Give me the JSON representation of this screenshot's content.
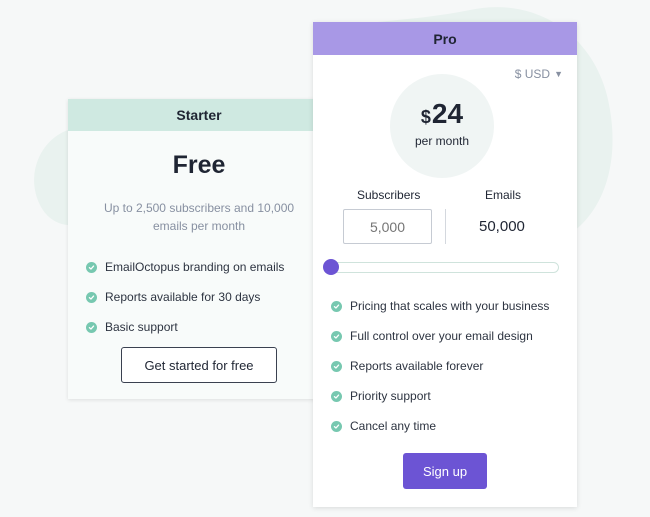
{
  "colors": {
    "starter_header": "#cfe9e1",
    "pro_header": "#a898e6",
    "accent": "#6c54d4",
    "check": "#77c8b0"
  },
  "starter": {
    "title": "Starter",
    "price": "Free",
    "description": "Up to 2,500 subscribers and 10,000 emails per month",
    "features": [
      "EmailOctopus branding on emails",
      "Reports available for 30 days",
      "Basic support"
    ],
    "cta_label": "Get started for free"
  },
  "pro": {
    "title": "Pro",
    "currency_selector": "$ USD",
    "currency_symbol": "$",
    "price": "24",
    "period": "per month",
    "subscribers_label": "Subscribers",
    "subscribers_placeholder": "5,000",
    "emails_label": "Emails",
    "emails_value": "50,000",
    "slider_level": 0,
    "features": [
      "Pricing that scales with your business",
      "Full control over your email design",
      "Reports available forever",
      "Priority support",
      "Cancel any time"
    ],
    "cta_label": "Sign up"
  }
}
